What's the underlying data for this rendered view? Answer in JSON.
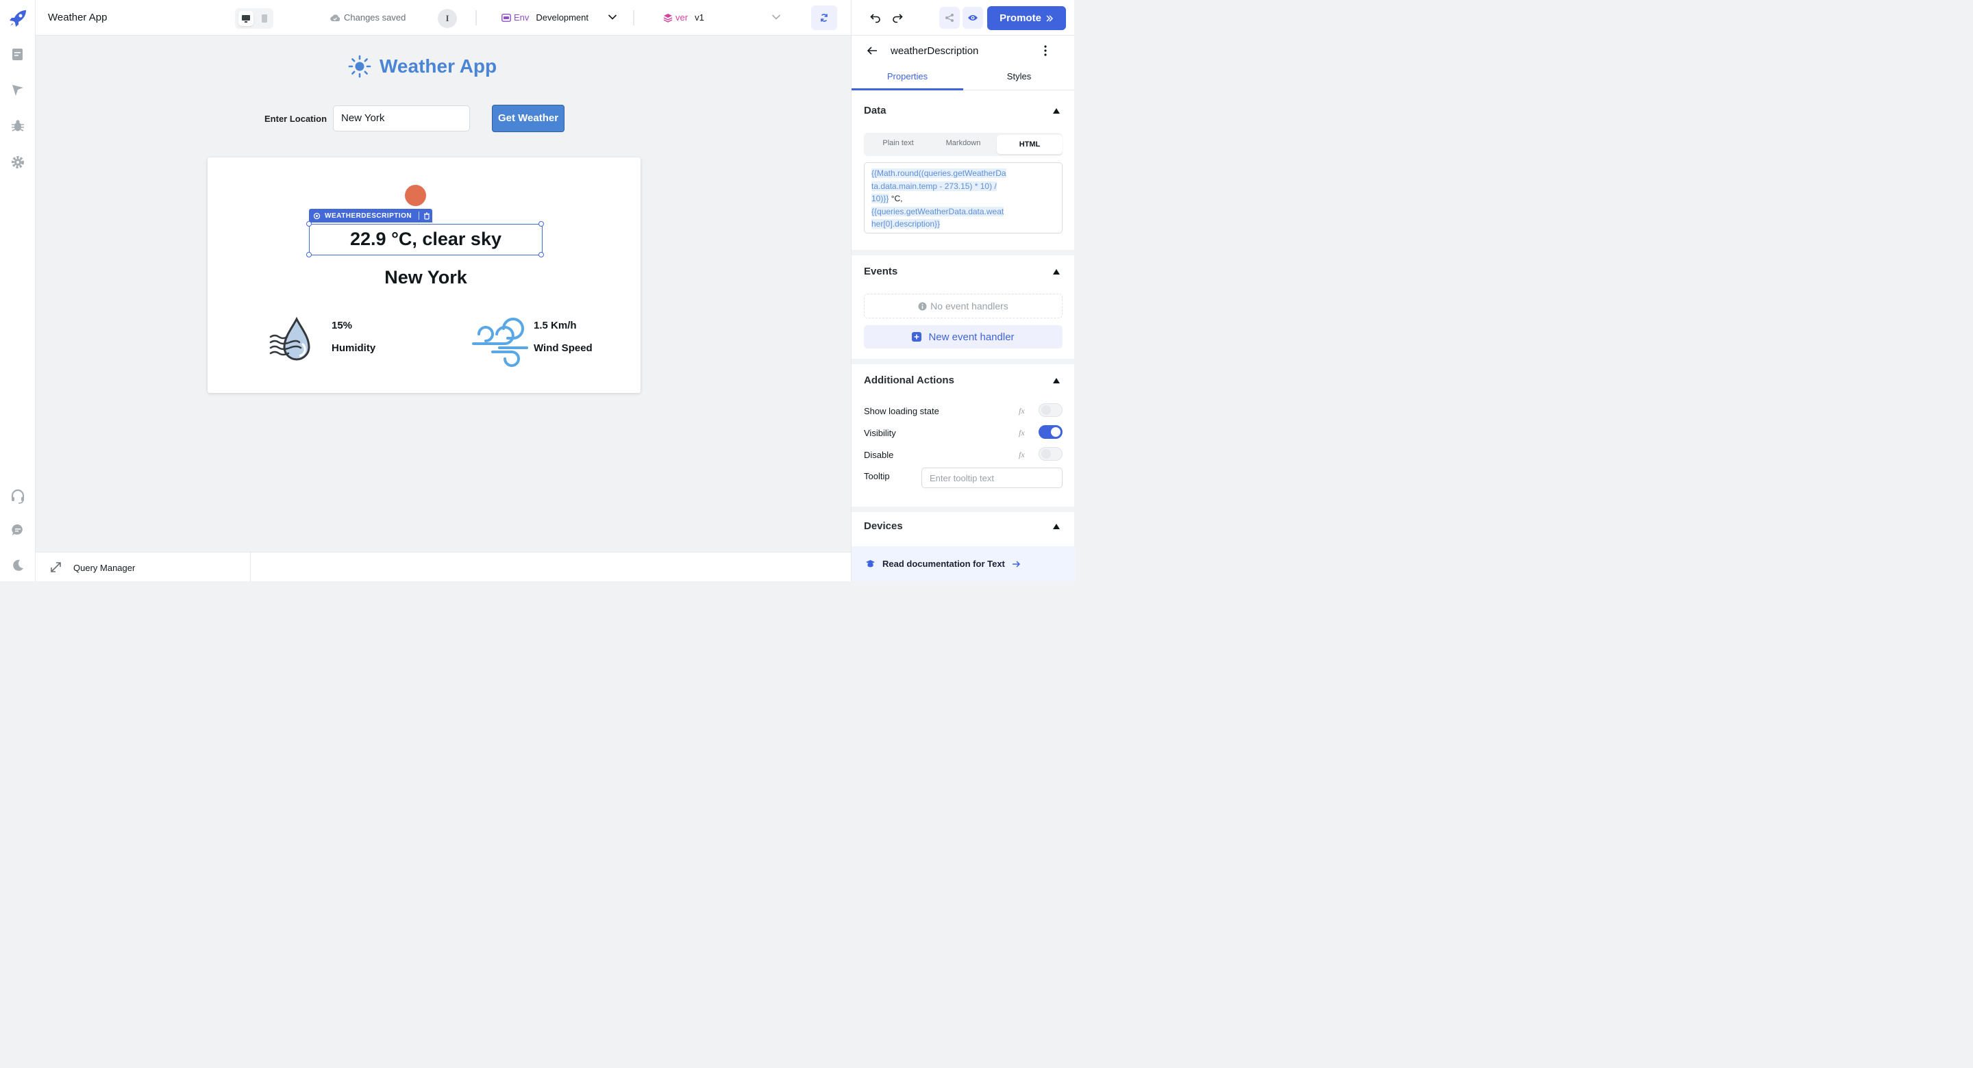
{
  "app": {
    "title": "Weather App"
  },
  "topbar": {
    "save_status": "Changes saved",
    "info_letter": "I",
    "env_label": "Env",
    "env_value": "Development",
    "ver_label": "ver",
    "ver_value": "v1",
    "promote_label": "Promote"
  },
  "canvas": {
    "title": "Weather App",
    "location_label": "Enter Location",
    "location_value": "New York",
    "get_weather_label": "Get Weather",
    "component_tag": "WEATHERDESCRIPTION",
    "temperature_text": "22.9 °C, clear sky",
    "city_text": "New York",
    "humidity_value": "15%",
    "humidity_label": "Humidity",
    "wind_value": "1.5 Km/h",
    "wind_label": "Wind Speed"
  },
  "query_manager": {
    "label": "Query Manager"
  },
  "inspector": {
    "component_name": "weatherDescription",
    "tabs": [
      "Properties",
      "Styles"
    ],
    "data_section": "Data",
    "data_modes": [
      "Plain text",
      "Markdown",
      "HTML"
    ],
    "code_lines": [
      {
        "text": "{{Math.round((queries.getWeatherDa",
        "highlight": true
      },
      {
        "text": "ta.data.main.temp - 273.15) * 10) /",
        "highlight": true
      },
      {
        "text": "10)}}",
        "highlight": true,
        "suffix": " °C,"
      },
      {
        "text": "{{queries.getWeatherData.data.weat",
        "highlight": true
      },
      {
        "text": "her[0].description}}",
        "highlight": true
      }
    ],
    "events_section": "Events",
    "no_event_handlers": "No event handlers",
    "new_event_handler": "New event handler",
    "actions_section": "Additional Actions",
    "actions": [
      {
        "label": "Show loading state",
        "fx": "fx",
        "enabled": false
      },
      {
        "label": "Visibility",
        "fx": "fx",
        "enabled": true
      },
      {
        "label": "Disable",
        "fx": "fx",
        "enabled": false
      }
    ],
    "tooltip_label": "Tooltip",
    "tooltip_placeholder": "Enter tooltip text",
    "devices_section": "Devices",
    "docs_link": "Read documentation for Text"
  },
  "colors": {
    "brand": "#3e63dd",
    "app_accent": "#4a84d4",
    "sun_dot": "#e07050"
  }
}
